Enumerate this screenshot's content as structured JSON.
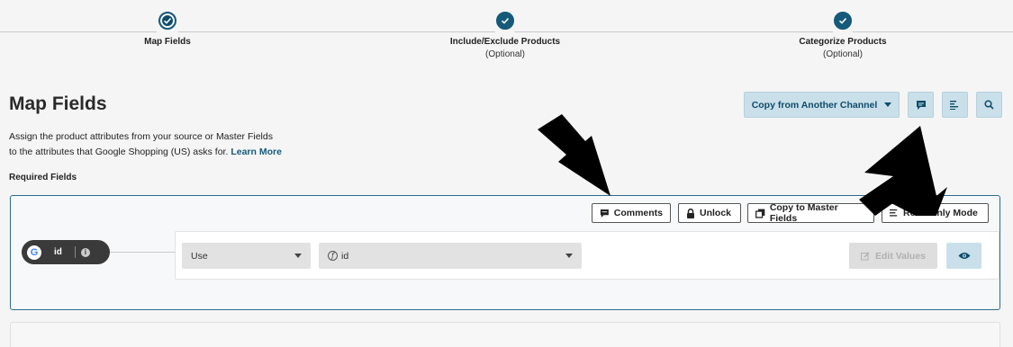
{
  "stepper": {
    "steps": [
      {
        "label": "Map Fields",
        "sub": ""
      },
      {
        "label": "Include/Exclude Products",
        "sub": "(Optional)"
      },
      {
        "label": "Categorize Products",
        "sub": "(Optional)"
      }
    ]
  },
  "header": {
    "title": "Map Fields",
    "description_line1": "Assign the product attributes from your source or Master Fields",
    "description_line2": "to the attributes that Google Shopping (US) asks for.",
    "learn_more": "Learn More",
    "copy_channel_label": "Copy from Another Channel"
  },
  "required_label": "Required Fields",
  "panel": {
    "comments_label": "Comments",
    "unlock_label": "Unlock",
    "copy_master_label": "Copy to Master Fields",
    "read_only_label": "Read-Only Mode",
    "field_name": "id",
    "use_select": "Use",
    "value_select": "id",
    "edit_values_label": "Edit Values"
  },
  "colors": {
    "accent": "#155a7a",
    "button_bg": "#c9dfe9",
    "panel_border": "#2d6c8a"
  },
  "icons": [
    "check-icon",
    "chevron-down-icon",
    "comment-icon",
    "list-icon",
    "search-icon",
    "lock-icon",
    "copy-icon",
    "google-icon",
    "info-icon",
    "function-icon",
    "edit-icon",
    "eye-icon",
    "arrow-pointer"
  ]
}
